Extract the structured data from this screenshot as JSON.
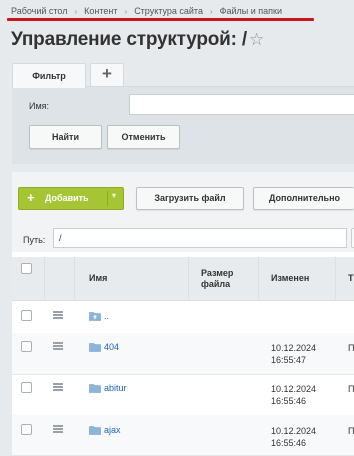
{
  "breadcrumb": [
    "Рабочий стол",
    "Контент",
    "Структура сайта",
    "Файлы и папки"
  ],
  "breadcrumb_sep": "›",
  "page": {
    "title": "Управление структурой: /",
    "star": "☆"
  },
  "filter": {
    "tab_label": "Фильтр",
    "add_tab": "+",
    "name_label": "Имя:",
    "name_value": "",
    "find_button": "Найти",
    "cancel_button": "Отменить"
  },
  "toolbar": {
    "add_icon": "+",
    "add_button": "Добавить",
    "add_caret": "▾",
    "upload_button": "Загрузить файл",
    "more_button": "Дополнительно"
  },
  "path": {
    "label": "Путь:",
    "value": "/"
  },
  "table": {
    "columns": {
      "name": "Имя",
      "size_line1": "Размер",
      "size_line2": "файла",
      "modified": "Изменен",
      "type_partial": "Т"
    },
    "rows": [
      {
        "name": "..",
        "date": "",
        "time": "",
        "type_partial": ""
      },
      {
        "name": "404",
        "date": "10.12.2024",
        "time": "16:55:47",
        "type_partial": "П"
      },
      {
        "name": "abitur",
        "date": "10.12.2024",
        "time": "16:55:46",
        "type_partial": "П"
      },
      {
        "name": "ajax",
        "date": "10.12.2024",
        "time": "16:55:46",
        "type_partial": "П"
      }
    ]
  },
  "colors": {
    "accent_red": "#c9161a",
    "add_green": "#a5c534",
    "link_blue": "#2067b0",
    "folder_blue": "#8db4d9"
  }
}
